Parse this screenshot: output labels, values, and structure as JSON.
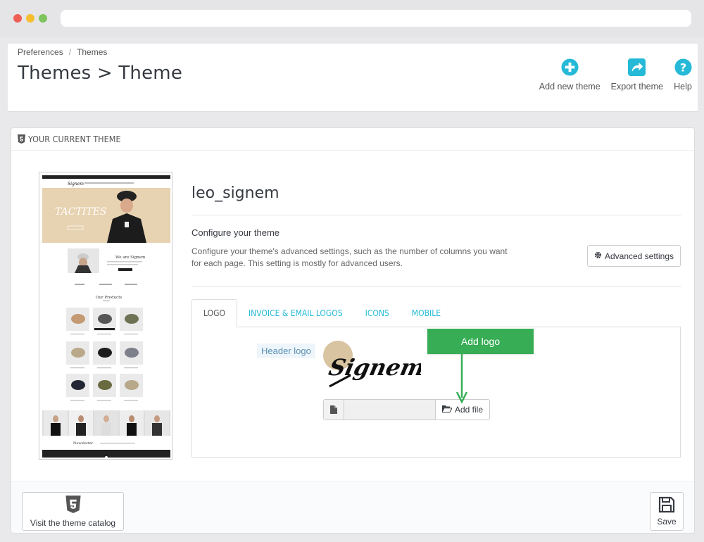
{
  "breadcrumb": {
    "items": [
      "Preferences",
      "Themes"
    ],
    "separator": "/"
  },
  "page": {
    "title": "Themes > Theme"
  },
  "toolbar": {
    "add_theme": "Add new theme",
    "export_theme": "Export theme",
    "help": "Help",
    "icons": [
      "plus-circle-icon",
      "export-share-icon",
      "help-circle-icon"
    ],
    "accent_color": "#25b9d7"
  },
  "panel": {
    "heading": "YOUR CURRENT THEME"
  },
  "theme": {
    "name": "leo_signem",
    "configure_title": "Configure your theme",
    "configure_desc": "Configure your theme's advanced settings, such as the number of columns you want for each page. This setting is mostly for advanced users.",
    "advanced_settings": "Advanced settings"
  },
  "tabs": [
    {
      "label": "LOGO",
      "active": true
    },
    {
      "label": "INVOICE & EMAIL LOGOS",
      "active": false
    },
    {
      "label": "ICONS",
      "active": false
    },
    {
      "label": "MOBILE",
      "active": false
    }
  ],
  "logo_tab": {
    "header_logo_label": "Header logo",
    "logo_text": "Signem",
    "add_file": "Add file"
  },
  "callout": {
    "label": "Add logo",
    "color": "#37ae56"
  },
  "footer": {
    "catalog_button": "Visit the theme catalog",
    "save_button": "Save"
  },
  "preview": {
    "hero_text": "TACTITES",
    "about_title": "We are Signem",
    "products_title": "Our Products",
    "newsletter": "Newsletter"
  }
}
